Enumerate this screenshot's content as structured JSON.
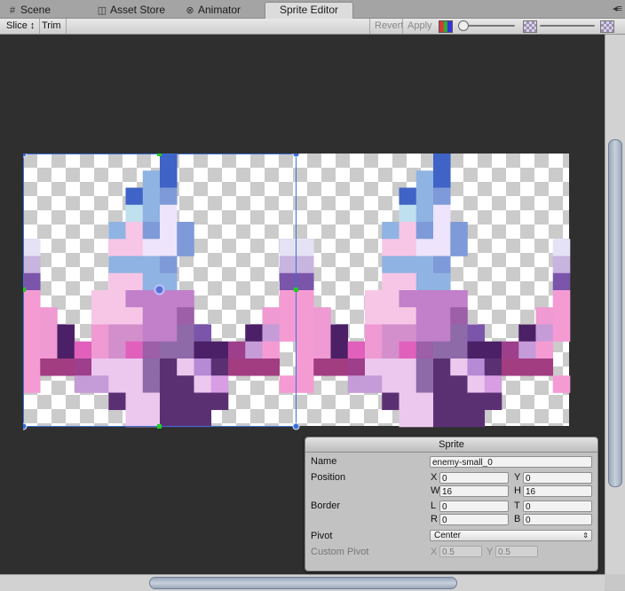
{
  "tabs": [
    {
      "label": "Scene",
      "icon": "hash-icon",
      "active": false
    },
    {
      "label": "Asset Store",
      "icon": "store-icon",
      "active": false
    },
    {
      "label": "Animator",
      "icon": "animator-icon",
      "active": false
    },
    {
      "label": "Sprite Editor",
      "icon": "",
      "active": true
    }
  ],
  "toolbar": {
    "slice_label": "Slice ↕",
    "trim_label": "Trim",
    "revert_label": "Revert",
    "apply_label": "Apply"
  },
  "sprite_panel": {
    "title": "Sprite",
    "name_label": "Name",
    "name_value": "enemy-small_0",
    "position_label": "Position",
    "x_label": "X",
    "x_value": "0",
    "y_label": "Y",
    "y_value": "0",
    "w_label": "W",
    "w_value": "16",
    "h_label": "H",
    "h_value": "16",
    "border_label": "Border",
    "l_label": "L",
    "l_value": "0",
    "t_label": "T",
    "t_value": "0",
    "r_label": "R",
    "r_value": "0",
    "b_label": "B",
    "b_value": "0",
    "pivot_label": "Pivot",
    "pivot_value": "Center",
    "custom_pivot_label": "Custom Pivot",
    "cx_label": "X",
    "cx_value": "0.5",
    "cy_label": "Y",
    "cy_value": "0.5"
  },
  "colors": {
    "canvas_bg": "#2f2f2f",
    "selection": "#3a6fd8",
    "handle_green": "#22cc22"
  }
}
